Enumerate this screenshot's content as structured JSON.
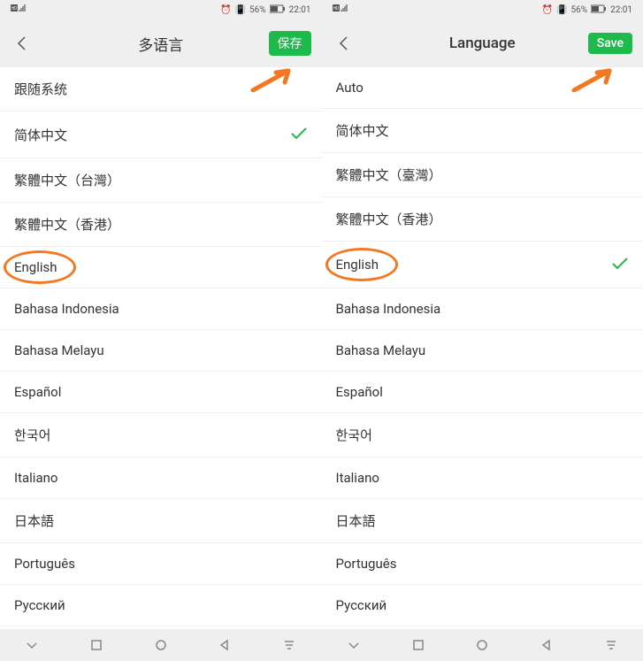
{
  "left": {
    "status": {
      "network": "HD 4G",
      "battery": "56%",
      "time": "22:01",
      "alarm": "⏰",
      "vibrate": "📳"
    },
    "header": {
      "title": "多语言",
      "save_label": "保存"
    },
    "languages": [
      {
        "label": "跟随系统",
        "selected": false,
        "highlight": false
      },
      {
        "label": "简体中文",
        "selected": true,
        "highlight": false
      },
      {
        "label": "繁體中文（台灣）",
        "selected": false,
        "highlight": false
      },
      {
        "label": "繁體中文（香港）",
        "selected": false,
        "highlight": false
      },
      {
        "label": "English",
        "selected": false,
        "highlight": true
      },
      {
        "label": "Bahasa Indonesia",
        "selected": false,
        "highlight": false
      },
      {
        "label": "Bahasa Melayu",
        "selected": false,
        "highlight": false
      },
      {
        "label": "Español",
        "selected": false,
        "highlight": false
      },
      {
        "label": "한국어",
        "selected": false,
        "highlight": false
      },
      {
        "label": "Italiano",
        "selected": false,
        "highlight": false
      },
      {
        "label": "日本語",
        "selected": false,
        "highlight": false
      },
      {
        "label": "Português",
        "selected": false,
        "highlight": false
      },
      {
        "label": "Русский",
        "selected": false,
        "highlight": false
      }
    ]
  },
  "right": {
    "status": {
      "network": "HD 4G",
      "battery": "56%",
      "time": "22:01",
      "alarm": "⏰",
      "vibrate": "📳"
    },
    "header": {
      "title": "Language",
      "save_label": "Save"
    },
    "languages": [
      {
        "label": "Auto",
        "selected": false,
        "highlight": false
      },
      {
        "label": "简体中文",
        "selected": false,
        "highlight": false
      },
      {
        "label": "繁體中文（臺灣）",
        "selected": false,
        "highlight": false
      },
      {
        "label": "繁體中文（香港）",
        "selected": false,
        "highlight": false
      },
      {
        "label": "English",
        "selected": true,
        "highlight": true
      },
      {
        "label": "Bahasa Indonesia",
        "selected": false,
        "highlight": false
      },
      {
        "label": "Bahasa Melayu",
        "selected": false,
        "highlight": false
      },
      {
        "label": "Español",
        "selected": false,
        "highlight": false
      },
      {
        "label": "한국어",
        "selected": false,
        "highlight": false
      },
      {
        "label": "Italiano",
        "selected": false,
        "highlight": false
      },
      {
        "label": "日本語",
        "selected": false,
        "highlight": false
      },
      {
        "label": "Português",
        "selected": false,
        "highlight": false
      },
      {
        "label": "Русский",
        "selected": false,
        "highlight": false
      }
    ]
  }
}
